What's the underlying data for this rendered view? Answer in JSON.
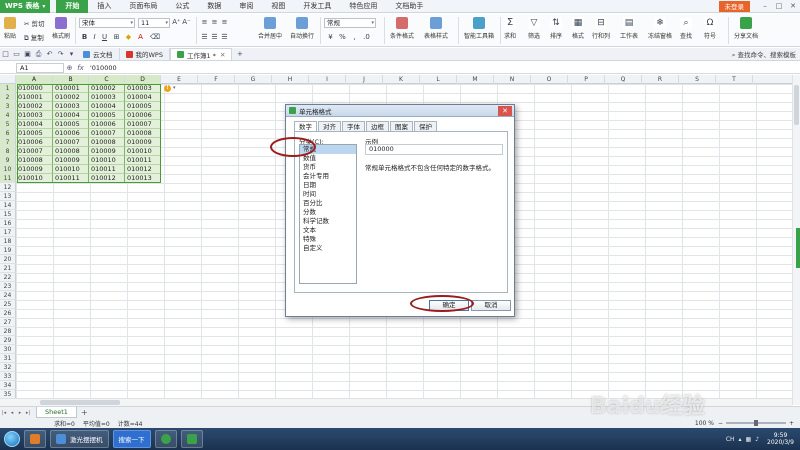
{
  "app": {
    "name": "WPS 表格",
    "login": "未登录"
  },
  "menu": [
    "开始",
    "插入",
    "页面布局",
    "公式",
    "数据",
    "审阅",
    "视图",
    "开发工具",
    "特色应用",
    "文档助手"
  ],
  "ribbon": {
    "paste": "粘贴",
    "cut": "剪切",
    "copy": "复制",
    "format_painter": "格式刷",
    "font_name": "宋体",
    "font_size": "11",
    "merge_center": "合并居中",
    "wrap_text": "自动换行",
    "number_format": "常规",
    "conditional_format": "条件格式",
    "table_style": "表格样式",
    "smart_toolbox": "智能工具箱",
    "sum": "求和",
    "filter": "筛选",
    "sort": "排序",
    "format": "格式",
    "row_col": "行和列",
    "worksheet": "工作表",
    "freeze": "冻结窗格",
    "find": "查找",
    "symbol": "符号",
    "share": "分享文档"
  },
  "doc_tabs": [
    {
      "label": "云文档",
      "color": "#4a8fd8"
    },
    {
      "label": "我的WPS",
      "color": "#d9362b"
    },
    {
      "label": "工作簿1 *",
      "color": "#3aa34a"
    }
  ],
  "help_search": "查找命令、搜索模板",
  "formula_bar": {
    "cell_ref": "A1",
    "value": "'010000"
  },
  "columns": [
    "A",
    "B",
    "C",
    "D",
    "E",
    "F",
    "G",
    "H",
    "I",
    "J",
    "K",
    "L",
    "M",
    "N",
    "O",
    "P",
    "Q",
    "R",
    "S",
    "T"
  ],
  "rows": [
    "1",
    "2",
    "3",
    "4",
    "5",
    "6",
    "7",
    "8",
    "9",
    "10",
    "11",
    "12",
    "13",
    "14",
    "15",
    "16",
    "17",
    "18",
    "19",
    "20",
    "21",
    "22",
    "23",
    "24",
    "25",
    "26",
    "27",
    "28",
    "29",
    "30",
    "31",
    "32",
    "33",
    "34",
    "35"
  ],
  "cells": [
    [
      "010000",
      "010001",
      "010002",
      "010003"
    ],
    [
      "010001",
      "010002",
      "010003",
      "010004"
    ],
    [
      "010002",
      "010003",
      "010004",
      "010005"
    ],
    [
      "010003",
      "010004",
      "010005",
      "010006"
    ],
    [
      "010004",
      "010005",
      "010006",
      "010007"
    ],
    [
      "010005",
      "010006",
      "010007",
      "010008"
    ],
    [
      "010006",
      "010007",
      "010008",
      "010009"
    ],
    [
      "010007",
      "010008",
      "010009",
      "010010"
    ],
    [
      "010008",
      "010009",
      "010010",
      "010011"
    ],
    [
      "010009",
      "010010",
      "010011",
      "010012"
    ],
    [
      "010010",
      "010011",
      "010012",
      "010013"
    ]
  ],
  "sheet": {
    "name": "Sheet1"
  },
  "status": {
    "sum": "求和=0",
    "avg": "平均值=0",
    "count": "计数=44",
    "zoom": "100 %"
  },
  "dialog": {
    "title": "单元格格式",
    "tabs": [
      "数字",
      "对齐",
      "字体",
      "边框",
      "图案",
      "保护"
    ],
    "category_label": "分类(C):",
    "categories": [
      "常规",
      "数值",
      "货币",
      "会计专用",
      "日期",
      "时间",
      "百分比",
      "分数",
      "科学记数",
      "文本",
      "特殊",
      "自定义"
    ],
    "selected_category": 0,
    "example_label": "示例",
    "example_value": "010000",
    "description": "常规单元格格式不包含任何特定的数字格式。",
    "ok": "确定",
    "cancel": "取消"
  },
  "taskbar": {
    "items": [
      "激光摆摆机",
      "搜索一下"
    ],
    "lang": "CH",
    "time": "9:59",
    "date": "2020/3/9"
  },
  "colors": {
    "brand_green": "#3aa34a",
    "selection_fill": "#e4f1da",
    "annotation_red": "#9b1c1c"
  }
}
